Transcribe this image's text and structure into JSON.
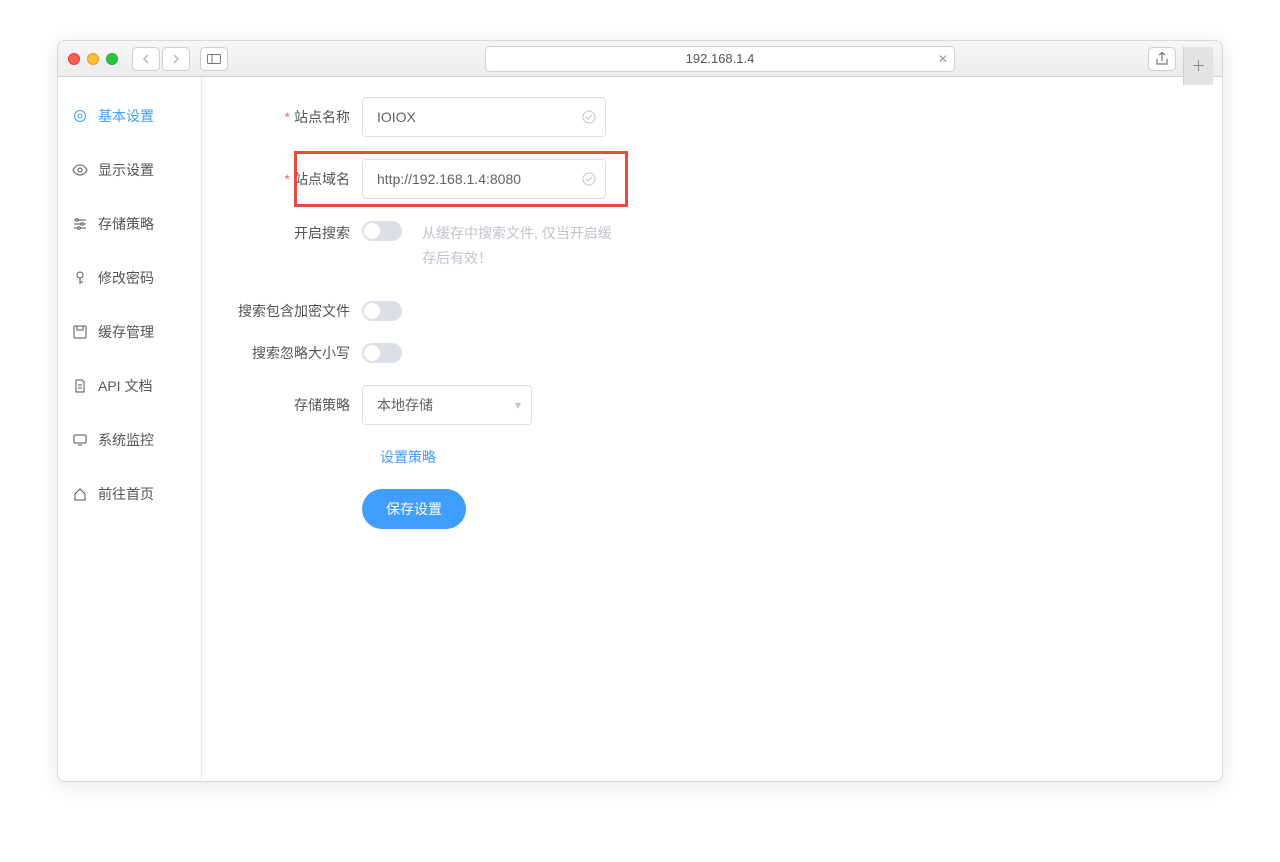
{
  "browser": {
    "url": "192.168.1.4"
  },
  "sidebar": {
    "items": [
      {
        "label": "基本设置"
      },
      {
        "label": "显示设置"
      },
      {
        "label": "存储策略"
      },
      {
        "label": "修改密码"
      },
      {
        "label": "缓存管理"
      },
      {
        "label": "API 文档"
      },
      {
        "label": "系统监控"
      },
      {
        "label": "前往首页"
      }
    ]
  },
  "form": {
    "site_name_label": "站点名称",
    "site_name_value": "IOIOX",
    "site_domain_label": "站点域名",
    "site_domain_value": "http://192.168.1.4:8080",
    "search_label": "开启搜索",
    "search_hint": "从缓存中搜索文件, 仅当开启缓存后有效！",
    "search_encrypt_label": "搜索包含加密文件",
    "search_ignorecase_label": "搜索忽略大小写",
    "storage_label": "存储策略",
    "storage_value": "本地存储",
    "storage_link": "设置策略",
    "save_button": "保存设置"
  }
}
